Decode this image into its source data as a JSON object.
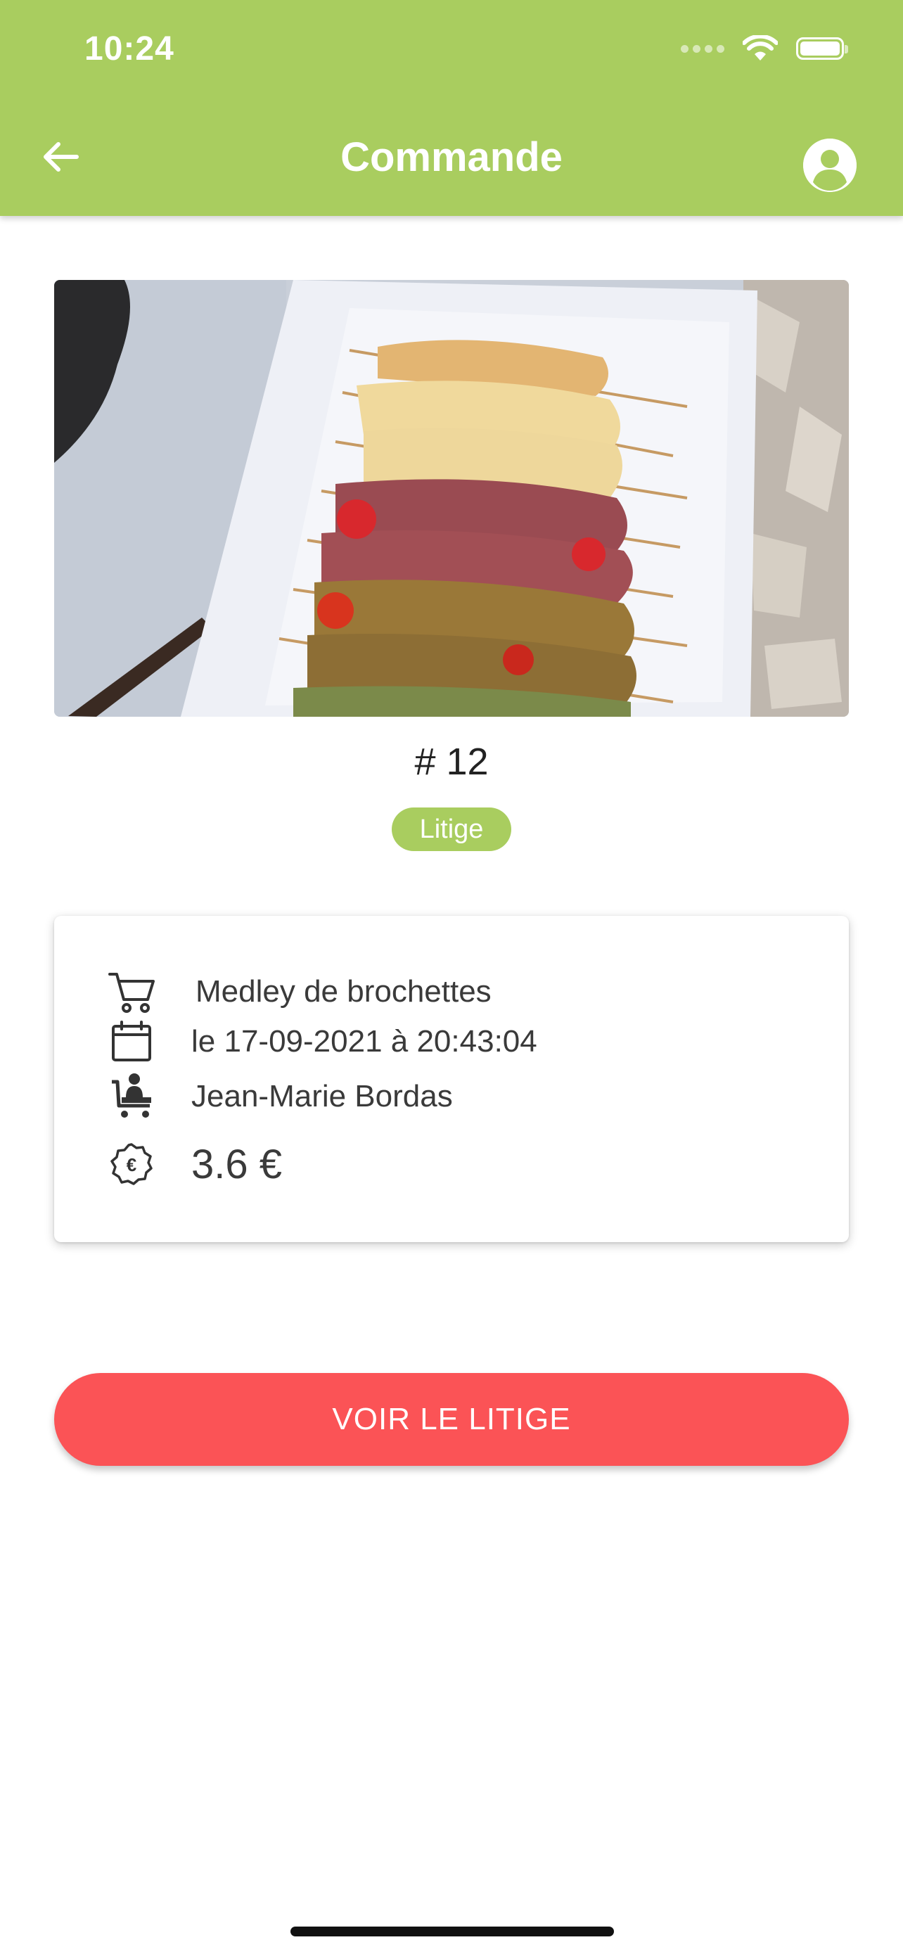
{
  "status_bar": {
    "time": "10:24",
    "icons": [
      "signal-icon",
      "wifi-icon",
      "battery-icon"
    ]
  },
  "header": {
    "title": "Commande",
    "back_icon": "arrow-left-icon",
    "profile_icon": "user-avatar-icon",
    "color": "#a9cd5f"
  },
  "order": {
    "number": "# 12",
    "status": "Litige",
    "product": "Medley de brochettes",
    "date": "le 17-09-2021 à 20:43:04",
    "customer": "Jean-Marie Bordas",
    "price": "3.6 €"
  },
  "icons": {
    "product": "cart-icon",
    "date": "calendar-icon",
    "customer": "customer-cart-icon",
    "price": "euro-badge-icon"
  },
  "actions": {
    "view_dispute_label": "VOIR LE LITIGE",
    "color": "#fb5356"
  }
}
